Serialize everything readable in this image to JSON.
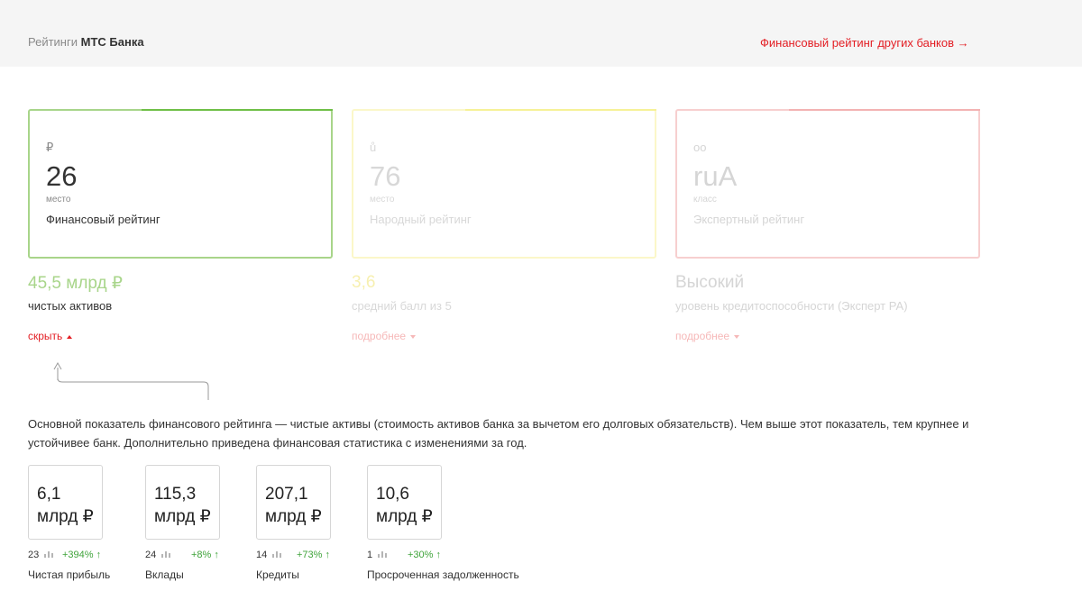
{
  "header": {
    "crumb_prefix": "Рейтинги",
    "bank_name": "МТС Банка",
    "other_banks_link": "Финансовый рейтинг других банков →"
  },
  "cards": [
    {
      "icon": "ruble-icon",
      "icon_glyph": "₽",
      "value": "26",
      "unit": "место",
      "name": "Финансовый рейтинг",
      "accent": "#6fbf47"
    },
    {
      "icon": "smile-icon",
      "icon_glyph": "ů",
      "value": "76",
      "unit": "место",
      "name": "Народный рейтинг",
      "accent": "#f6f197"
    },
    {
      "icon": "glasses-icon",
      "icon_glyph": "oo",
      "value": "ruA",
      "unit": "класс",
      "name": "Экспертный рейтинг",
      "accent": "#f3b3b3"
    }
  ],
  "summaries": [
    {
      "value": "45,5 млрд ₽",
      "subtitle": "чистых активов",
      "toggle": "скрыть"
    },
    {
      "value": "3,6",
      "subtitle": "средний балл из 5",
      "toggle": "подробнее"
    },
    {
      "value": "Высокий",
      "subtitle": "уровень кредитоспособности (Эксперт РА)",
      "toggle": "подробнее"
    }
  ],
  "description": "Основной показатель финансового рейтинга — чистые активы (стоимость активов банка за вычетом его долговых обязательств). Чем выше этот показатель, тем крупнее и устойчивее банк. Дополнительно приведена финансовая статистика с изменениями за год.",
  "stats": [
    {
      "value_line1": "6,1",
      "value_line2": "млрд ₽",
      "rank": "23",
      "change": "+394% ↑",
      "label": "Чистая прибыль"
    },
    {
      "value_line1": "115,3",
      "value_line2": "млрд ₽",
      "rank": "24",
      "change": "+8% ↑",
      "label": "Вклады"
    },
    {
      "value_line1": "207,1",
      "value_line2": "млрд ₽",
      "rank": "14",
      "change": "+73% ↑",
      "label": "Кредиты"
    },
    {
      "value_line1": "10,6",
      "value_line2": "млрд ₽",
      "rank": "1",
      "change": "+30% ↑",
      "label": "Просроченная задолженность"
    }
  ],
  "colors": {
    "brand_red": "#e31e24",
    "positive_green": "#3fa33a",
    "financial_green": "#a8d58a"
  }
}
